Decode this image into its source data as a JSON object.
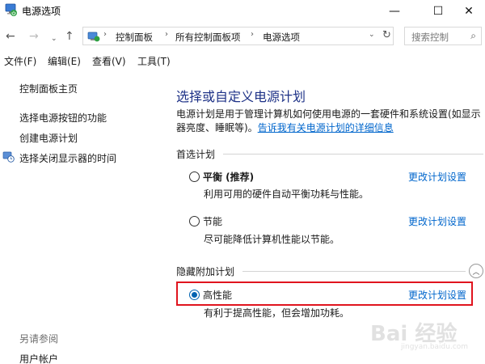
{
  "window": {
    "title": "电源选项",
    "controls": {
      "minimize": "—",
      "maximize": "☐",
      "close": "✕"
    }
  },
  "address": {
    "back_icon": "←",
    "forward_icon": "→",
    "recent_icon": "⌄",
    "up_icon": "↑",
    "breadcrumbs": [
      "控制面板",
      "所有控制面板项",
      "电源选项"
    ],
    "separator": "›",
    "dropdown_icon": "⌄",
    "refresh_icon": "↻"
  },
  "search": {
    "placeholder": "搜索控制",
    "icon": "⌕"
  },
  "menu": [
    "文件(F)",
    "编辑(E)",
    "查看(V)",
    "工具(T)"
  ],
  "left_pane": {
    "home": "控制面板主页",
    "links": [
      "选择电源按钮的功能",
      "创建电源计划",
      "选择关闭显示器的时间"
    ],
    "see_also_label": "另请参阅",
    "see_also_links": [
      "用户帐户"
    ]
  },
  "main": {
    "title": "选择或自定义电源计划",
    "description": "电源计划是用于管理计算机如何使用电源的一套硬件和系统设置(如显示器亮度、睡眠等)。",
    "description_link": "告诉我有关电源计划的详细信息",
    "preferred_label": "首选计划",
    "hidden_label": "隐藏附加计划",
    "collapse_icon": "︿",
    "plans": [
      {
        "name": "平衡 (推荐)",
        "desc": "利用可用的硬件自动平衡功耗与性能。",
        "link": "更改计划设置",
        "selected": false
      },
      {
        "name": "节能",
        "desc": "尽可能降低计算机性能以节能。",
        "link": "更改计划设置",
        "selected": false
      },
      {
        "name": "高性能",
        "desc": "有利于提高性能，但会增加功耗。",
        "link": "更改计划设置",
        "selected": true
      }
    ]
  },
  "watermark": {
    "text": "Bai 经验",
    "sub": "jingyan.baidu.com"
  },
  "colors": {
    "title": "#1e3287",
    "link": "#0066cc",
    "highlight": "#e0141e",
    "radio": "#0063b1"
  }
}
